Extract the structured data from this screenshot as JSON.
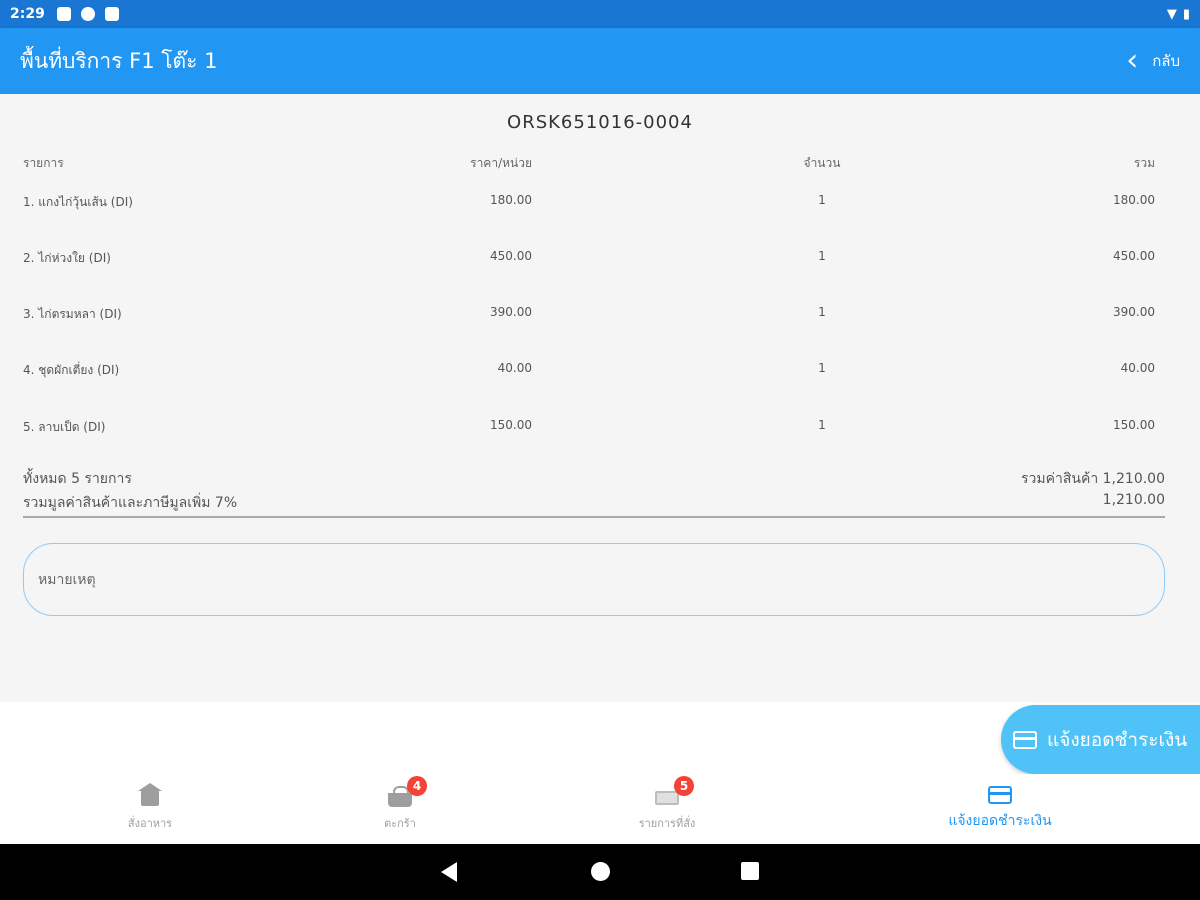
{
  "status_bar": {
    "time": "2:29"
  },
  "app_bar": {
    "title": "พื้นที่บริการ F1 โต๊ะ 1",
    "back_label": "กลับ"
  },
  "order": {
    "number": "ORSK651016-0004",
    "headers": {
      "item": "รายการ",
      "unit_price": "ราคา/หน่วย",
      "qty": "จำนวน",
      "total": "รวม"
    },
    "items": [
      {
        "name": "1.  แกงไก่วุ้นเส้น (DI)",
        "price": "180.00",
        "qty": "1",
        "total": "180.00"
      },
      {
        "name": "2.  ไก่ห่วงใย (DI)",
        "price": "450.00",
        "qty": "1",
        "total": "450.00"
      },
      {
        "name": "3.  ไก่ตรมหลา (DI)",
        "price": "390.00",
        "qty": "1",
        "total": "390.00"
      },
      {
        "name": "4.  ชุดผักเตี่ยง  (DI)",
        "price": "40.00",
        "qty": "1",
        "total": "40.00"
      },
      {
        "name": "5.  ลาบเป็ด (DI)",
        "price": "150.00",
        "qty": "1",
        "total": "150.00"
      }
    ],
    "summary_count": "ทั้งหมด 5 รายการ",
    "summary_subtotal": "รวมค่าสินค้า 1,210.00",
    "summary_vat_label": "รวมมูลค่าสินค้าและภาษีมูลเพิ่ม 7%",
    "summary_vat_total": "1,210.00"
  },
  "remark": {
    "placeholder": "หมายเหตุ"
  },
  "fab": {
    "label": "แจ้งยอดชำระเงิน"
  },
  "bottom_nav": {
    "items": [
      {
        "label": "สั่งอาหาร",
        "badge": ""
      },
      {
        "label": "ตะกร้า",
        "badge": "4"
      },
      {
        "label": "รายการที่สั่ง",
        "badge": "5"
      },
      {
        "label": "แจ้งยอดชำระเงิน",
        "badge": ""
      }
    ]
  },
  "colors": {
    "primary": "#2196f3",
    "status_bar": "#1976d2",
    "fab": "#4fc3f7",
    "badge": "#f44336"
  }
}
